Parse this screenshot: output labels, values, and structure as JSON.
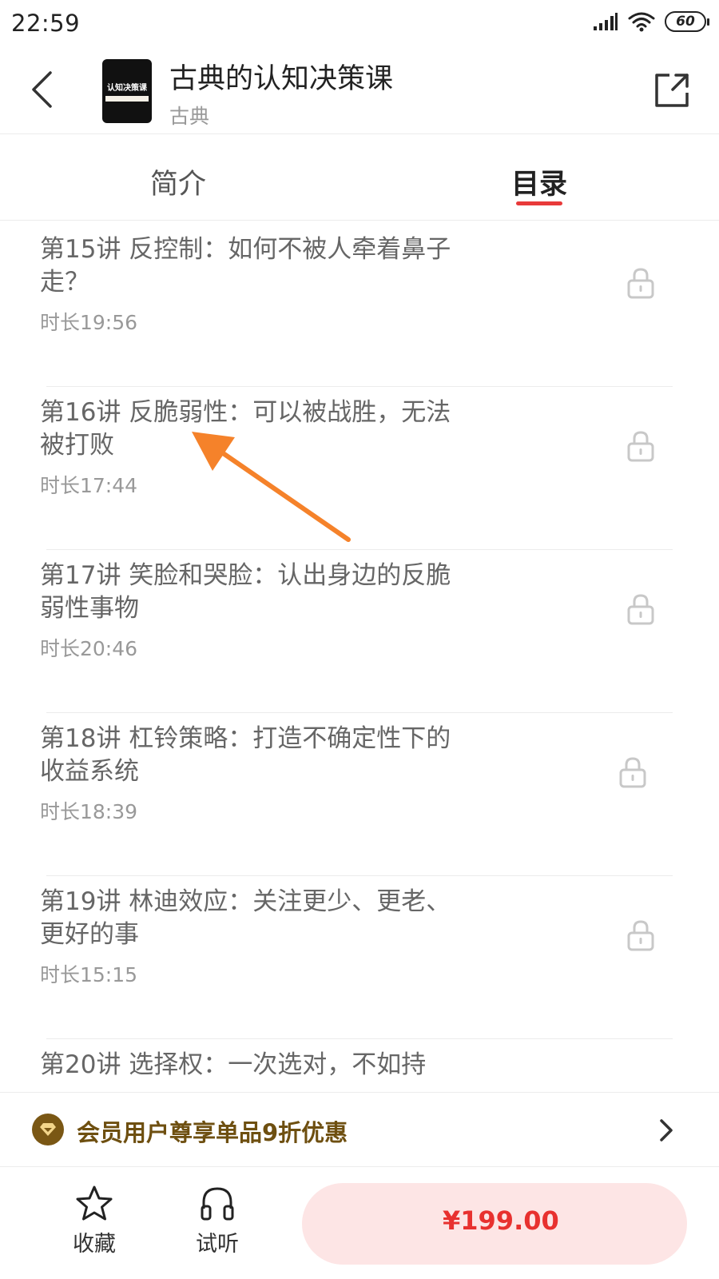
{
  "status_bar": {
    "time": "22:59",
    "battery": "60",
    "icons": [
      "signal-icon",
      "wifi-icon",
      "battery-icon"
    ]
  },
  "header": {
    "title": "古典的认知决策课",
    "subtitle": "古典",
    "cover_title": "认知决策课"
  },
  "tabs": [
    {
      "label": "简介",
      "active": false
    },
    {
      "label": "目录",
      "active": true
    }
  ],
  "lessons": [
    {
      "title": "第15讲 反控制：如何不被人牵着鼻子走？",
      "duration": "时长19:56",
      "locked": true
    },
    {
      "title": "第16讲 反脆弱性：可以被战胜，无法被打败",
      "duration": "时长17:44",
      "locked": true
    },
    {
      "title": "第17讲 笑脸和哭脸：认出身边的反脆弱性事物",
      "duration": "时长20:46",
      "locked": true
    },
    {
      "title": "第18讲 杠铃策略：打造不确定性下的收益系统",
      "duration": "时长18:39",
      "locked": true
    },
    {
      "title": "第19讲 林迪效应：关注更少、更老、更好的事",
      "duration": "时长15:15",
      "locked": true
    },
    {
      "title": "第20讲 选择权：一次选对，不如持",
      "duration": "",
      "locked": true
    }
  ],
  "member_bar": {
    "text": "会员用户尊享单品9折优惠"
  },
  "bottom_bar": {
    "favorite_label": "收藏",
    "listen_label": "试听",
    "price": "¥199.00"
  },
  "colors": {
    "accent_red": "#e83a3a",
    "price_red": "#e8312f",
    "buy_bg": "#fde5e5",
    "member_gold": "#6e4f10",
    "annotation_orange": "#f5822a"
  }
}
